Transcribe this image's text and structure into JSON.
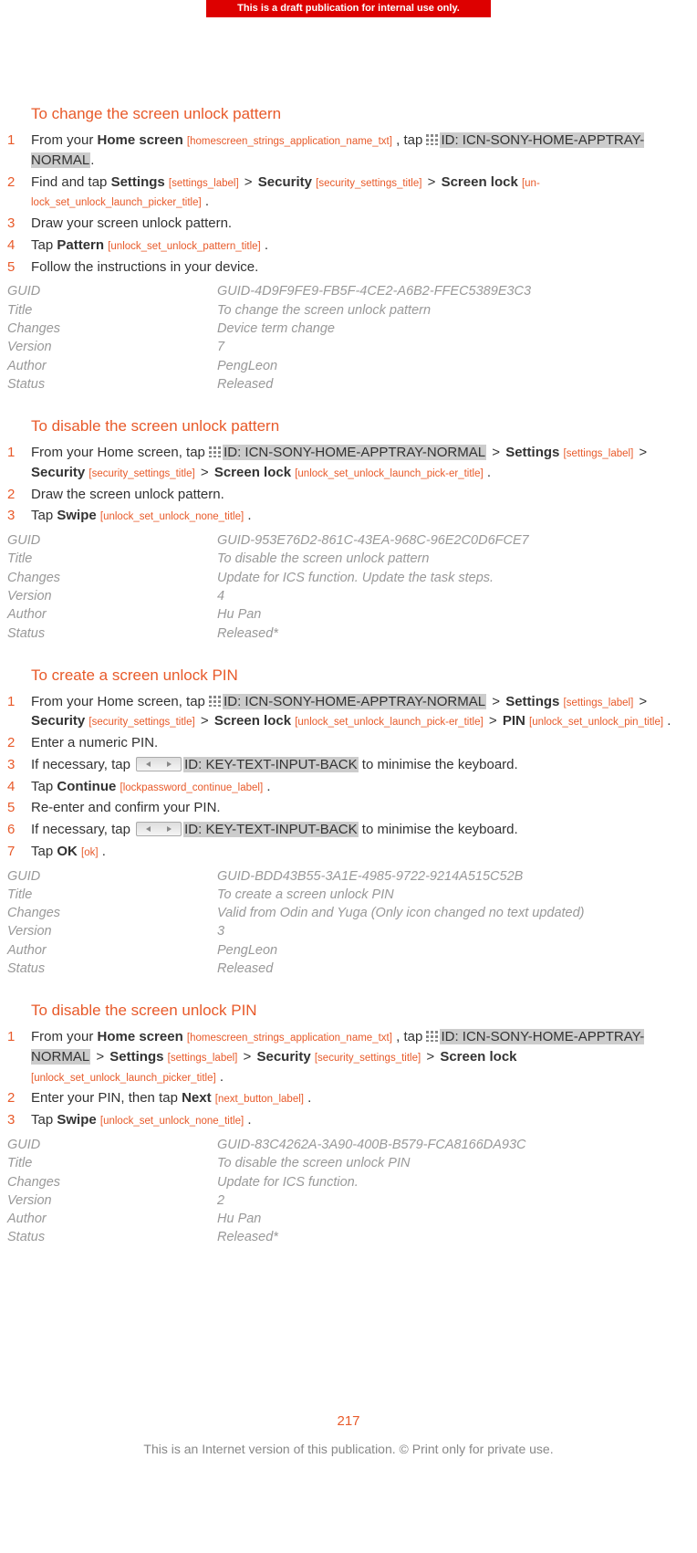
{
  "banner": "This is a draft publication for internal use only.",
  "page_number": "217",
  "footer": "This is an Internet version of this publication. © Print only for private use.",
  "ids": {
    "homescreen": "[homescreen_strings_application_name_txt]",
    "apptray": "ID: ICN-SONY-HOME-APPTRAY-NORMAL",
    "settings": "[settings_label]",
    "security": "[security_settings_title]",
    "launch_picker_1": "[un-lock_set_unlock_launch_picker_title]",
    "launch_picker_2": "[unlock_set_unlock_launch_pick-er_title]",
    "launch_picker_3": "[unlock_set_unlock_launch_picker_title]",
    "pattern": "[unlock_set_unlock_pattern_title]",
    "swipe": "[unlock_set_unlock_none_title]",
    "pin": "[unlock_set_unlock_pin_title]",
    "key_back": "ID: KEY-TEXT-INPUT-BACK",
    "continue": "[lockpassword_continue_label]",
    "ok": "[ok]",
    "next": "[next_button_label]"
  },
  "sections": [
    {
      "title": "To change the screen unlock pattern",
      "steps_key": "s1",
      "meta": {
        "GUID": "GUID-4D9F9FE9-FB5F-4CE2-A6B2-FFEC5389E3C3",
        "Title": "To change the screen unlock pattern",
        "Changes": "Device term change",
        "Version": "7",
        "Author": "PengLeon",
        "Status": "Released"
      }
    },
    {
      "title": "To disable the screen unlock pattern",
      "steps_key": "s2",
      "meta": {
        "GUID": "GUID-953E76D2-861C-43EA-968C-96E2C0D6FCE7",
        "Title": "To disable the screen unlock pattern",
        "Changes": "Update for ICS function. Update the task steps.",
        "Version": "4",
        "Author": "Hu Pan",
        "Status": "Released*"
      }
    },
    {
      "title": "To create a screen unlock PIN",
      "steps_key": "s3",
      "meta": {
        "GUID": "GUID-BDD43B55-3A1E-4985-9722-9214A515C52B",
        "Title": "To create a screen unlock PIN",
        "Changes": "Valid from Odin and Yuga (Only icon changed no text updated)",
        "Version": "3",
        "Author": "PengLeon",
        "Status": "Released"
      }
    },
    {
      "title": "To disable the screen unlock PIN",
      "steps_key": "s4",
      "meta": {
        "GUID": "GUID-83C4262A-3A90-400B-B579-FCA8166DA93C",
        "Title": "To disable the screen unlock PIN",
        "Changes": "Update for ICS function.",
        "Version": "2",
        "Author": "Hu Pan",
        "Status": "Released*"
      }
    }
  ],
  "text": {
    "from_your": "From your ",
    "home_screen": "Home screen",
    "from_your_home_screen_tap": "From your Home screen, tap ",
    "comma_tap": " , tap ",
    "period": ".",
    "gt": " > ",
    "find_and_tap": "Find and tap ",
    "settings": "Settings",
    "security": "Security",
    "screen_lock": "Screen lock",
    "draw_pattern": "Draw your screen unlock pattern.",
    "tap": "Tap ",
    "pattern": "Pattern",
    "follow_instructions": "Follow the instructions in your device.",
    "draw_the_pattern": "Draw the screen unlock pattern.",
    "swipe": "Swipe",
    "pin": "PIN",
    "enter_numeric_pin": "Enter a numeric PIN.",
    "if_necessary_tap": "If necessary, tap ",
    "to_min_kb": " to minimise the keyboard.",
    "continue": "Continue",
    "reenter": "Re-enter and confirm your PIN.",
    "ok": "OK",
    "enter_pin_then_tap": "Enter your PIN, then tap ",
    "next": "Next",
    "meta_labels": {
      "guid": "GUID",
      "title": "Title",
      "changes": "Changes",
      "version": "Version",
      "author": "Author",
      "status": "Status"
    }
  }
}
